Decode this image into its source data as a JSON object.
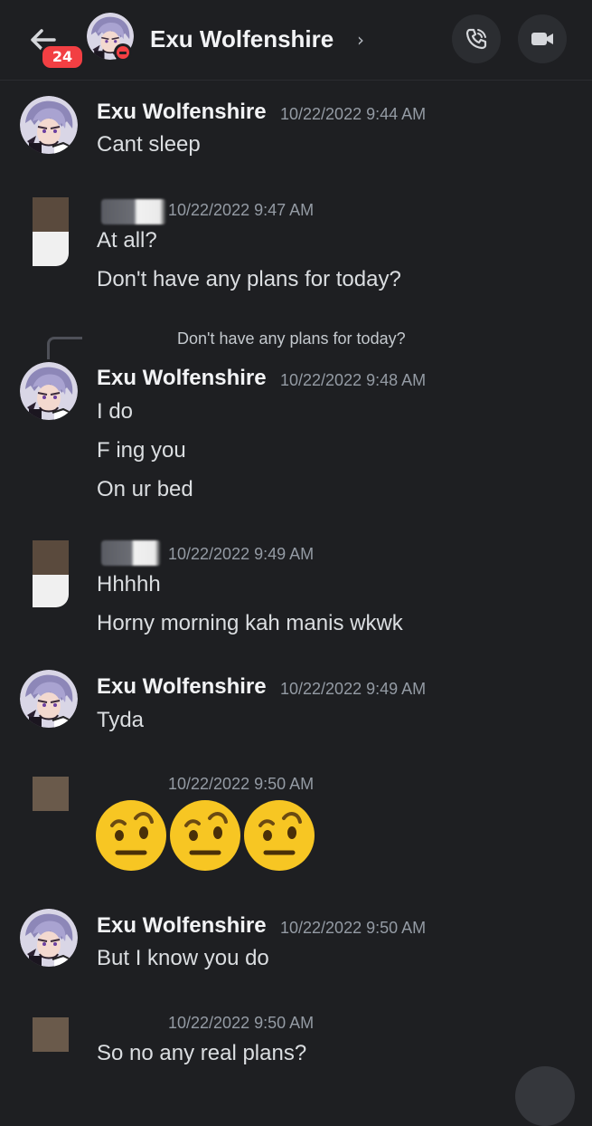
{
  "header": {
    "title": "Exu Wolfenshire",
    "badge_count": "24",
    "chevron": "›"
  },
  "messages": [
    {
      "author": "Exu Wolfenshire",
      "time": "10/22/2022 9:44 AM",
      "lines": [
        "Cant sleep"
      ]
    },
    {
      "author": "",
      "time": "10/22/2022 9:47 AM",
      "lines": [
        "At all?",
        "Don't have any plans for today?"
      ]
    },
    {
      "reply_preview": "Don't have any plans for today?",
      "author": "Exu Wolfenshire",
      "time": "10/22/2022 9:48 AM",
      "lines": [
        "I do",
        "F ing you",
        "On ur bed"
      ]
    },
    {
      "author": "",
      "time": "10/22/2022 9:49 AM",
      "lines": [
        "Hhhhh",
        "Horny morning kah manis wkwk"
      ]
    },
    {
      "author": "Exu Wolfenshire",
      "time": "10/22/2022 9:49 AM",
      "lines": [
        "Tyda"
      ]
    },
    {
      "author": "",
      "time": "10/22/2022 9:50 AM",
      "emoji": "face-with-raised-eyebrow",
      "emoji_count": 3
    },
    {
      "author": "Exu Wolfenshire",
      "time": "10/22/2022 9:50 AM",
      "lines": [
        "But I know you do"
      ]
    },
    {
      "author": "",
      "time": "10/22/2022 9:50 AM",
      "lines": [
        "So no any real plans?"
      ]
    }
  ],
  "colors": {
    "background": "#1e1f22",
    "badge": "#f23f43",
    "dnd_status": "#f23f43",
    "timestamp": "#949ba4"
  },
  "icons": {
    "back": "back-arrow-icon",
    "call": "phone-icon",
    "video": "video-camera-icon",
    "status": "do-not-disturb-icon"
  }
}
